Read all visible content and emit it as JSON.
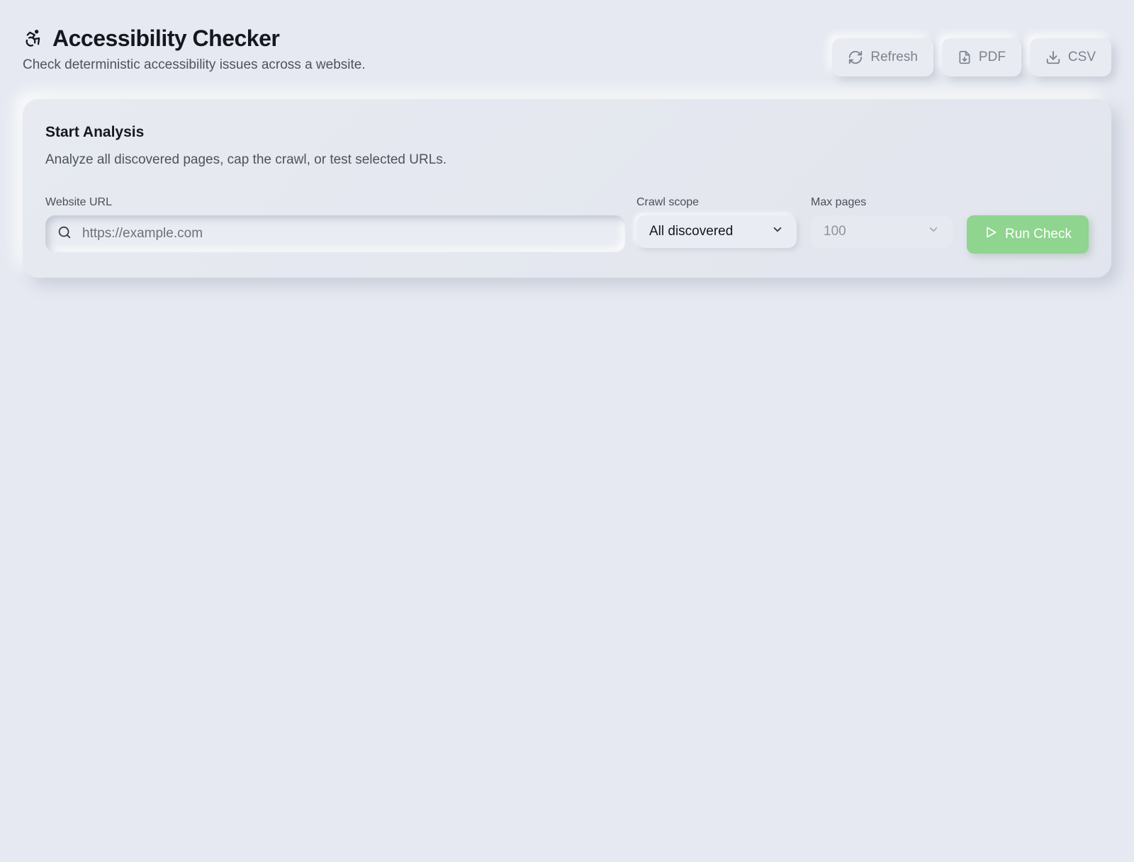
{
  "header": {
    "title": "Accessibility Checker",
    "subtitle": "Check deterministic accessibility issues across a website.",
    "icon": "accessibility-icon"
  },
  "toolbar": {
    "refresh_label": "Refresh",
    "pdf_label": "PDF",
    "csv_label": "CSV",
    "refresh_icon": "refresh-icon",
    "pdf_icon": "file-download-icon",
    "csv_icon": "download-icon"
  },
  "analysis": {
    "title": "Start Analysis",
    "description": "Analyze all discovered pages, cap the crawl, or test selected URLs.",
    "url_label": "Website URL",
    "url_placeholder": "https://example.com",
    "url_value": "",
    "scope_label": "Crawl scope",
    "scope_value": "All discovered",
    "max_pages_label": "Max pages",
    "max_pages_value": "100",
    "run_label": "Run Check",
    "run_color": "#8fd48f"
  }
}
